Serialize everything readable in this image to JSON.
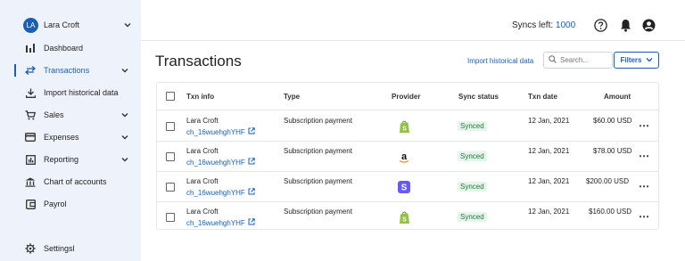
{
  "user": {
    "initials": "LA",
    "name": "Lara Croft"
  },
  "sidebar": {
    "items": [
      {
        "label": "Dashboard",
        "icon": "bar-chart-icon",
        "has_chevron": false,
        "active": false
      },
      {
        "label": "Transactions",
        "icon": "swap-arrows-icon",
        "has_chevron": true,
        "active": true
      },
      {
        "label": "Import historical data",
        "icon": "download-icon",
        "has_chevron": false,
        "active": false
      },
      {
        "label": "Sales",
        "icon": "cart-icon",
        "has_chevron": true,
        "active": false
      },
      {
        "label": "Expenses",
        "icon": "credit-card-icon",
        "has_chevron": true,
        "active": false
      },
      {
        "label": "Reporting",
        "icon": "report-icon",
        "has_chevron": true,
        "active": false
      },
      {
        "label": "Chart of accounts",
        "icon": "bank-icon",
        "has_chevron": false,
        "active": false
      },
      {
        "label": "Payrol",
        "icon": "wallet-icon",
        "has_chevron": false,
        "active": false
      }
    ],
    "settings_label": "Settingsl"
  },
  "header": {
    "syncs_label": "Syncs left:",
    "syncs_count": "1000"
  },
  "page": {
    "title": "Transactions",
    "import_link": "Import historical data",
    "search_placeholder": "Search...",
    "filters_label": "Filters"
  },
  "table": {
    "columns": [
      "Txn info",
      "Type",
      "Provider",
      "Sync status",
      "Txn date",
      "Amount"
    ],
    "rows": [
      {
        "name": "Lara Croft",
        "id": "ch_16wuehghYHF",
        "type": "Subscription payment",
        "provider": "shopify",
        "status": "Synced",
        "date": "12 Jan, 2021",
        "amount": "$60.00 USD"
      },
      {
        "name": "Lara Croft",
        "id": "ch_16wuehghYHF",
        "type": "Subscription payment",
        "provider": "amazon",
        "status": "Synced",
        "date": "12 Jan, 2021",
        "amount": "$78.00 USD"
      },
      {
        "name": "Lara Croft",
        "id": "ch_16wuehghYHF",
        "type": "Subscription payment",
        "provider": "stripe",
        "status": "Synced",
        "date": "12 Jan, 2021",
        "amount": "$200.00 USD"
      },
      {
        "name": "Lara Croft",
        "id": "ch_16wuehghYHF",
        "type": "Subscription payment",
        "provider": "shopify",
        "status": "Synced",
        "date": "12 Jan, 2021",
        "amount": "$160.00 USD"
      }
    ]
  },
  "colors": {
    "accent": "#1a5fb4",
    "synced_bg": "#e6f4ea",
    "synced_text": "#1e7b3c",
    "sidebar_bg": "#eef2fa"
  }
}
